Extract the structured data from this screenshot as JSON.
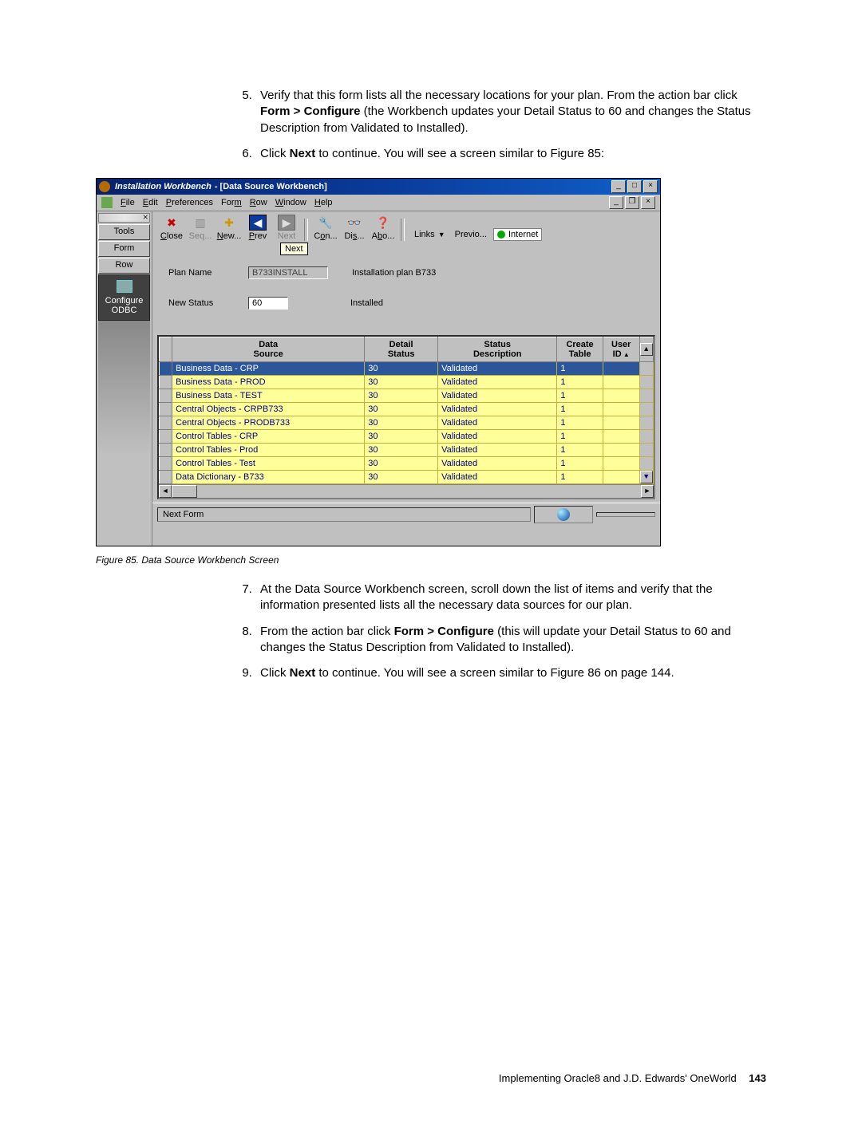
{
  "instructions_top": [
    {
      "n": "5.",
      "html": "Verify that this form lists all the necessary locations for your plan. From the action bar click <b>Form > Configure</b> (the Workbench updates your Detail Status to 60 and changes the Status Description from Validated to Installed)."
    },
    {
      "n": "6.",
      "html": "Click <b>Next</b> to continue. You will see a screen similar to Figure 85:"
    }
  ],
  "figure_caption": "Figure 85.  Data Source Workbench Screen",
  "instructions_bottom": [
    {
      "n": "7.",
      "html": "At the Data Source Workbench screen, scroll down the list of items and verify that the information presented lists all the necessary data sources for our plan."
    },
    {
      "n": "8.",
      "html": "From the action bar click <b>Form > Configure</b> (this will update your Detail Status to 60 and changes the Status Description from Validated to Installed)."
    },
    {
      "n": "9.",
      "html": "Click <b>Next</b> to continue. You will see a screen similar to Figure 86 on page 144."
    }
  ],
  "footer_text": "Implementing Oracle8 and J.D. Edwards' OneWorld",
  "footer_page": "143",
  "window": {
    "title_app": "Installation Workbench",
    "title_doc": " - [Data Source Workbench]"
  },
  "menu": [
    "File",
    "Edit",
    "Preferences",
    "Form",
    "Row",
    "Window",
    "Help"
  ],
  "left_buttons": [
    "Tools",
    "Form",
    "Row"
  ],
  "left_dark": "Configure ODBC",
  "toolbar": {
    "close": "Close",
    "seq": "Seq...",
    "new": "New...",
    "prev": "Prev",
    "next": "Next",
    "con": "Con...",
    "dis": "Dis...",
    "abo": "Abo...",
    "links": "Links",
    "previo": "Previo...",
    "internet": "Internet"
  },
  "tooltip": "Next",
  "form": {
    "plan_label": "Plan Name",
    "plan_value": "B733INSTALL",
    "plan_desc": "Installation plan B733",
    "status_label": "New Status",
    "status_value": "60",
    "status_desc": "Installed"
  },
  "grid": {
    "headers": {
      "ds": "Data\nSource",
      "detail": "Detail\nStatus",
      "sdesc": "Status\nDescription",
      "ct": "Create\nTable",
      "uid": "User\nID"
    },
    "rows": [
      {
        "ds": "Business Data - CRP",
        "detail": "30",
        "sdesc": "Validated",
        "ct": "1",
        "uid": ""
      },
      {
        "ds": "Business Data - PROD",
        "detail": "30",
        "sdesc": "Validated",
        "ct": "1",
        "uid": ""
      },
      {
        "ds": "Business Data - TEST",
        "detail": "30",
        "sdesc": "Validated",
        "ct": "1",
        "uid": ""
      },
      {
        "ds": "Central Objects - CRPB733",
        "detail": "30",
        "sdesc": "Validated",
        "ct": "1",
        "uid": ""
      },
      {
        "ds": "Central Objects - PRODB733",
        "detail": "30",
        "sdesc": "Validated",
        "ct": "1",
        "uid": ""
      },
      {
        "ds": "Control Tables - CRP",
        "detail": "30",
        "sdesc": "Validated",
        "ct": "1",
        "uid": ""
      },
      {
        "ds": "Control Tables - Prod",
        "detail": "30",
        "sdesc": "Validated",
        "ct": "1",
        "uid": ""
      },
      {
        "ds": "Control Tables - Test",
        "detail": "30",
        "sdesc": "Validated",
        "ct": "1",
        "uid": ""
      },
      {
        "ds": "Data Dictionary - B733",
        "detail": "30",
        "sdesc": "Validated",
        "ct": "1",
        "uid": ""
      }
    ]
  },
  "statusbar": "Next Form"
}
